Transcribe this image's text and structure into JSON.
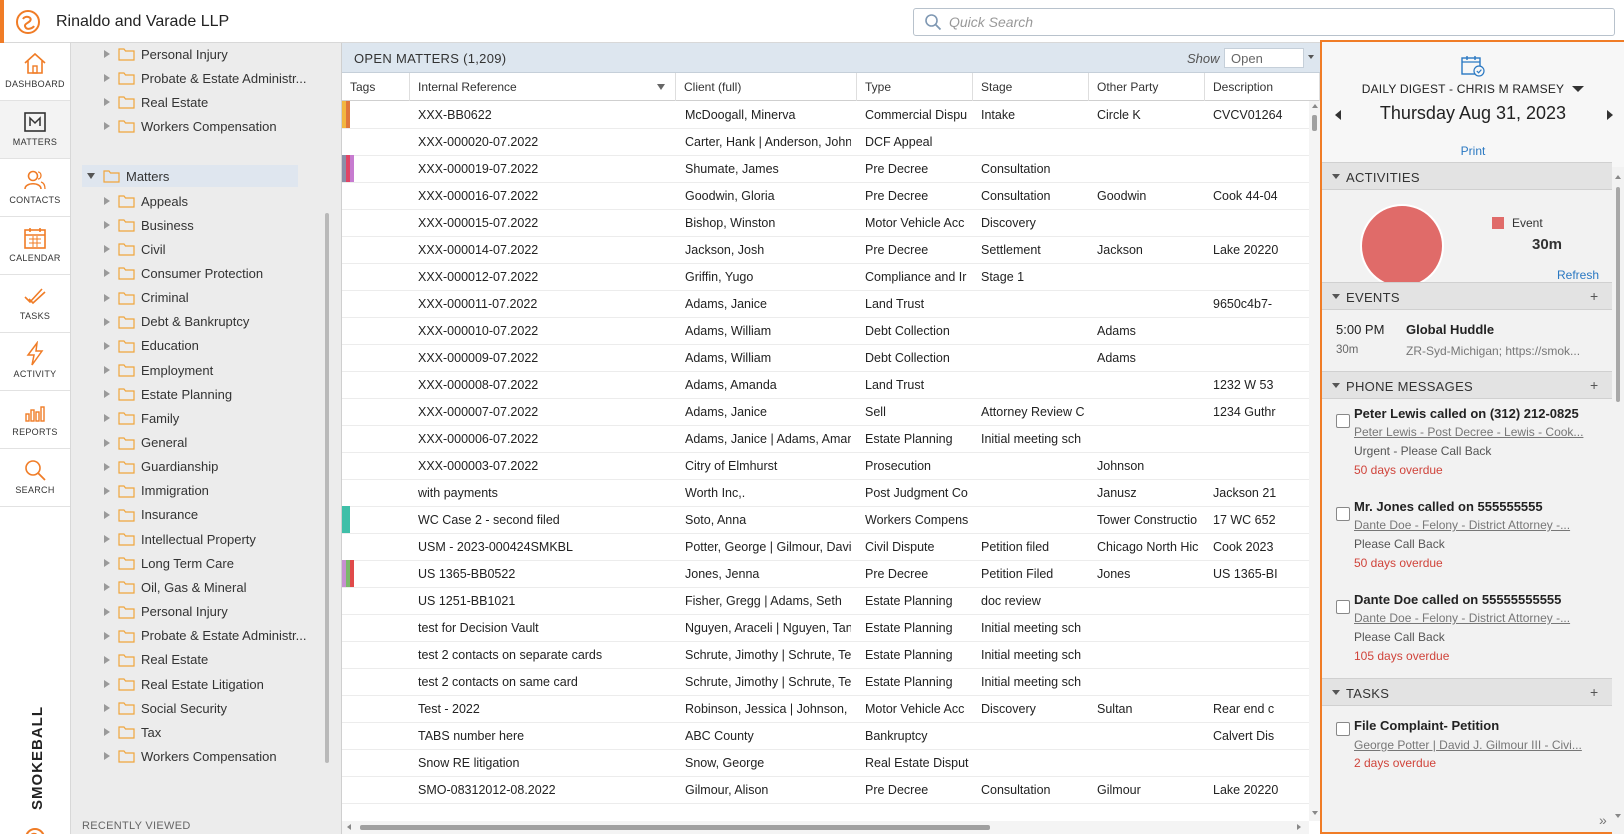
{
  "app": {
    "firm_name": "Rinaldo and Varade LLP",
    "search_placeholder": "Quick Search",
    "brand_wordmark": "SMOKEBALL",
    "accent_color": "#f07c26"
  },
  "nav": {
    "items": [
      {
        "label": "DASHBOARD",
        "icon": "house-icon"
      },
      {
        "label": "MATTERS",
        "icon": "matters-icon"
      },
      {
        "label": "CONTACTS",
        "icon": "contacts-icon"
      },
      {
        "label": "CALENDAR",
        "icon": "calendar-icon"
      },
      {
        "label": "TASKS",
        "icon": "tasks-icon"
      },
      {
        "label": "ACTIVITY",
        "icon": "lightning-icon"
      },
      {
        "label": "REPORTS",
        "icon": "reports-icon"
      },
      {
        "label": "SEARCH",
        "icon": "search-icon"
      }
    ]
  },
  "tree": {
    "top_items": [
      "Personal Injury",
      "Probate & Estate Administr...",
      "Real Estate",
      "Workers Compensation"
    ],
    "root": "Matters",
    "children": [
      "Appeals",
      "Business",
      "Civil",
      "Consumer Protection",
      "Criminal",
      "Debt & Bankruptcy",
      "Education",
      "Employment",
      "Estate Planning",
      "Family",
      "General",
      "Guardianship",
      "Immigration",
      "Insurance",
      "Intellectual Property",
      "Long Term Care",
      "Oil, Gas & Mineral",
      "Personal Injury",
      "Probate & Estate Administr...",
      "Real Estate",
      "Real Estate Litigation",
      "Social Security",
      "Tax",
      "Workers Compensation"
    ],
    "recently_viewed": "RECENTLY VIEWED"
  },
  "grid": {
    "title": "OPEN MATTERS (1,209)",
    "show_label": "Show",
    "show_value": "Open",
    "columns": [
      "Tags",
      "Internal Reference",
      "Client (full)",
      "Type",
      "Stage",
      "Other Party",
      "Description"
    ],
    "rows": [
      {
        "tags": [
          "#f2b640",
          "#e0763a"
        ],
        "ref": "XXX-BB0622",
        "client": "McDoogall, Minerva",
        "type": "Commercial Dispu",
        "stage": "Intake",
        "other": "Circle K",
        "desc": "CVCV01264"
      },
      {
        "tags": [],
        "ref": "XXX-000020-07.2022",
        "client": "Carter, Hank | Anderson, John",
        "type": "DCF Appeal",
        "stage": "",
        "other": "",
        "desc": ""
      },
      {
        "tags": [
          "#8b8fa8",
          "#e04466",
          "#c77bd0"
        ],
        "ref": "XXX-000019-07.2022",
        "client": "Shumate, James",
        "type": "Pre Decree",
        "stage": "Consultation",
        "other": "",
        "desc": ""
      },
      {
        "tags": [],
        "ref": "XXX-000016-07.2022",
        "client": "Goodwin, Gloria",
        "type": "Pre Decree",
        "stage": "Consultation",
        "other": "Goodwin",
        "desc": "Cook 44-04"
      },
      {
        "tags": [],
        "ref": "XXX-000015-07.2022",
        "client": "Bishop, Winston",
        "type": "Motor Vehicle Acc",
        "stage": "Discovery",
        "other": "",
        "desc": ""
      },
      {
        "tags": [],
        "ref": "XXX-000014-07.2022",
        "client": "Jackson, Josh",
        "type": "Pre Decree",
        "stage": "Settlement",
        "other": "Jackson",
        "desc": "Lake 20220"
      },
      {
        "tags": [],
        "ref": "XXX-000012-07.2022",
        "client": "Griffin, Yugo",
        "type": "Compliance and Ir",
        "stage": "Stage 1",
        "other": "",
        "desc": ""
      },
      {
        "tags": [],
        "ref": "XXX-000011-07.2022",
        "client": "Adams, Janice",
        "type": "Land Trust",
        "stage": "",
        "other": "",
        "desc": "9650c4b7-"
      },
      {
        "tags": [],
        "ref": "XXX-000010-07.2022",
        "client": "Adams, William",
        "type": "Debt Collection",
        "stage": "",
        "other": "Adams",
        "desc": ""
      },
      {
        "tags": [],
        "ref": "XXX-000009-07.2022",
        "client": "Adams, William",
        "type": "Debt Collection",
        "stage": "",
        "other": "Adams",
        "desc": ""
      },
      {
        "tags": [],
        "ref": "XXX-000008-07.2022",
        "client": "Adams, Amanda",
        "type": "Land Trust",
        "stage": "",
        "other": "",
        "desc": "1232 W 53"
      },
      {
        "tags": [],
        "ref": "XXX-000007-07.2022",
        "client": "Adams, Janice",
        "type": "Sell",
        "stage": "Attorney Review C",
        "other": "",
        "desc": "1234 Guthr"
      },
      {
        "tags": [],
        "ref": "XXX-000006-07.2022",
        "client": "Adams, Janice | Adams, Aman",
        "type": "Estate Planning",
        "stage": "Initial meeting sch",
        "other": "",
        "desc": ""
      },
      {
        "tags": [],
        "ref": "XXX-000003-07.2022",
        "client": "Citry of Elmhurst",
        "type": "Prosecution",
        "stage": "",
        "other": "Johnson",
        "desc": ""
      },
      {
        "tags": [],
        "ref": "with payments",
        "client": "Worth Inc,.",
        "type": "Post Judgment Co",
        "stage": "",
        "other": "Janusz",
        "desc": "Jackson 21"
      },
      {
        "tags": [
          "#3fbfa8",
          "#3fbfa8"
        ],
        "ref": "WC Case 2 - second filed",
        "client": "Soto, Anna",
        "type": "Workers Compens",
        "stage": "",
        "other": "Tower Constructio",
        "desc": "17 WC 652"
      },
      {
        "tags": [],
        "ref": "USM - 2023-000424SMKBL",
        "client": "Potter, George | Gilmour, Davi",
        "type": "Civil Dispute",
        "stage": "Petition filed",
        "other": "Chicago North Hic",
        "desc": "Cook 2023"
      },
      {
        "tags": [
          "#c78fd0",
          "#7bb86a",
          "#e04a4a"
        ],
        "ref": "US 1365-BB0522",
        "client": "Jones, Jenna",
        "type": "Pre Decree",
        "stage": "Petition Filed",
        "other": "Jones",
        "desc": "US 1365-BI"
      },
      {
        "tags": [],
        "ref": "US 1251-BB1021",
        "client": "Fisher, Gregg | Adams, Seth",
        "type": "Estate Planning",
        "stage": "doc review",
        "other": "",
        "desc": ""
      },
      {
        "tags": [],
        "ref": "test for Decision Vault",
        "client": "Nguyen, Araceli | Nguyen, Tan",
        "type": "Estate Planning",
        "stage": "Initial meeting sch",
        "other": "",
        "desc": ""
      },
      {
        "tags": [],
        "ref": "test 2 contacts on separate cards",
        "client": "Schrute, Jimothy | Schrute, Ter",
        "type": "Estate Planning",
        "stage": "Initial meeting sch",
        "other": "",
        "desc": ""
      },
      {
        "tags": [],
        "ref": "test 2 contacts on same card",
        "client": "Schrute, Jimothy | Schrute, Ter",
        "type": "Estate Planning",
        "stage": "Initial meeting sch",
        "other": "",
        "desc": ""
      },
      {
        "tags": [],
        "ref": "Test - 2022",
        "client": "Robinson, Jessica | Johnson, Jc",
        "type": "Motor Vehicle Acc",
        "stage": "Discovery",
        "other": "Sultan",
        "desc": "Rear end c"
      },
      {
        "tags": [],
        "ref": "TABS number here",
        "client": "ABC County",
        "type": "Bankruptcy",
        "stage": "",
        "other": "",
        "desc": "Calvert Dis"
      },
      {
        "tags": [],
        "ref": "Snow RE litigation",
        "client": "Snow, George",
        "type": "Real Estate Disput",
        "stage": "",
        "other": "",
        "desc": ""
      },
      {
        "tags": [],
        "ref": "SMO-08312012-08.2022",
        "client": "Gilmour, Alison",
        "type": "Pre Decree",
        "stage": "Consultation",
        "other": "Gilmour",
        "desc": "Lake 20220"
      }
    ]
  },
  "digest": {
    "title": "DAILY DIGEST - CHRIS M RAMSEY",
    "date": "Thursday Aug 31, 2023",
    "print": "Print",
    "activities": {
      "heading": "ACTIVITIES",
      "legend_label": "Event",
      "legend_value": "30m",
      "refresh": "Refresh",
      "slice_color": "#e06b69"
    },
    "events": {
      "heading": "EVENTS",
      "items": [
        {
          "time": "5:00 PM",
          "duration": "30m",
          "title": "Global Huddle",
          "location": "ZR-Syd-Michigan; https://smok..."
        }
      ]
    },
    "phone_messages": {
      "heading": "PHONE MESSAGES",
      "items": [
        {
          "title": "Peter Lewis called on (312) 212-0825",
          "matter": "Peter Lewis - Post Decree - Lewis - Cook...",
          "note": "Urgent - Please Call Back",
          "overdue": "50 days overdue"
        },
        {
          "title": "Mr. Jones called on 555555555",
          "matter": "Dante Doe - Felony - District Attorney -...",
          "note": "Please Call Back",
          "overdue": "50 days overdue"
        },
        {
          "title": "Dante Doe called on 55555555555",
          "matter": "Dante Doe - Felony - District Attorney -...",
          "note": "Please Call Back",
          "overdue": "105 days overdue"
        }
      ]
    },
    "tasks": {
      "heading": "TASKS",
      "items": [
        {
          "title": "File Complaint- Petition",
          "matter": "George Potter | David J. Gilmour III - Civi...",
          "overdue": "2 days overdue"
        }
      ]
    }
  }
}
